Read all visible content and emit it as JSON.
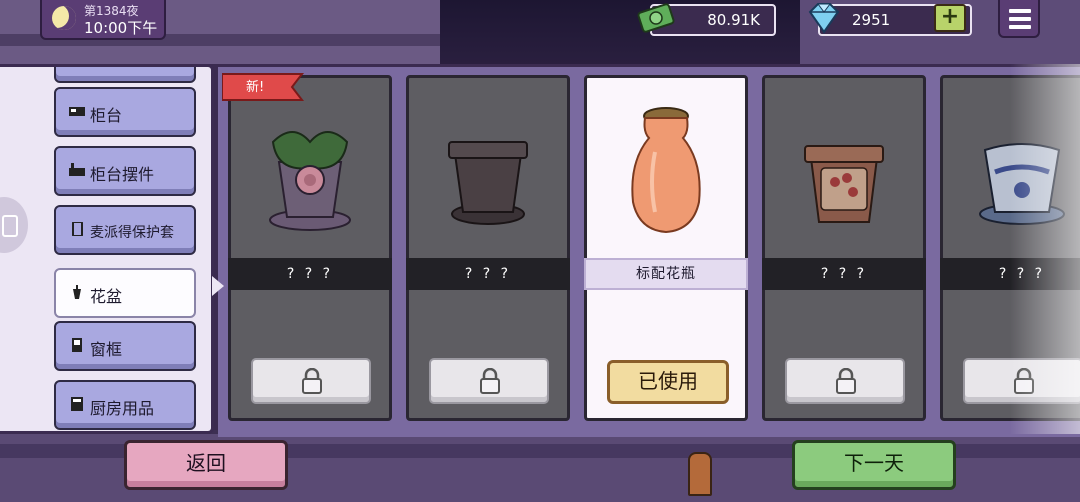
{
  "hud": {
    "night": "第1384夜",
    "clock": "10:00下午",
    "money": "80.91K",
    "gems": "2951",
    "plus": "+"
  },
  "sidebar": {
    "items": [
      {
        "label": "柜台",
        "icon": "counter-icon",
        "active": false
      },
      {
        "label": "柜台摆件",
        "icon": "counter-decor-icon",
        "active": false
      },
      {
        "label": "麦派得保护套",
        "icon": "phone-case-icon",
        "active": false
      },
      {
        "label": "花盆",
        "icon": "flowerpot-icon",
        "active": true
      },
      {
        "label": "窗框",
        "icon": "window-frame-icon",
        "active": false
      },
      {
        "label": "厨房用品",
        "icon": "kitchenware-icon",
        "active": false
      }
    ]
  },
  "cards": [
    {
      "name": "? ? ?",
      "locked": true,
      "badge": "新!",
      "art": "rose-pot"
    },
    {
      "name": "? ? ?",
      "locked": true,
      "art": "plain-pot"
    },
    {
      "name": "标配花瓶",
      "locked": false,
      "status": "已使用",
      "art": "orange-vase"
    },
    {
      "name": "? ? ?",
      "locked": true,
      "art": "floral-pot"
    },
    {
      "name": "? ? ?",
      "locked": true,
      "art": "blue-china-pot"
    }
  ],
  "footer": {
    "back": "返回",
    "next": "下一天"
  },
  "colors": {
    "back_button": "#e6a7c0",
    "next_button": "#8ccb7e",
    "selected_card": "#fbf6fc",
    "locked_card": "#5e5d62"
  }
}
